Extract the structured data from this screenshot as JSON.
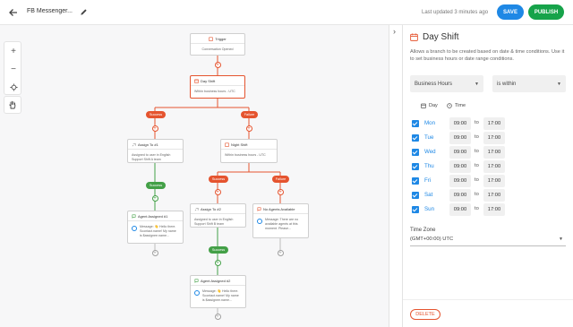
{
  "header": {
    "title": "FB Messenger...",
    "last_updated": "Last updated 3 minutes ago",
    "save_label": "SAVE",
    "publish_label": "PUBLISH"
  },
  "canvas": {
    "zoom_in": "+",
    "zoom_out": "−",
    "nodes": {
      "trigger": {
        "title": "Trigger",
        "body": "Conversation Opened"
      },
      "day_shift": {
        "title": "Day Shift",
        "body": "Within business hours - UTC"
      },
      "assign_1": {
        "title": "Assign To #1",
        "body": "Assigned to user in English Support Shift A team"
      },
      "night_shift": {
        "title": "Night Shift",
        "body": "Within business hours - UTC"
      },
      "agent_assigned_1": {
        "title": "Agent Assigned #1",
        "body": "Message: 👋 Hello there. Scontact.name! My name is $assignee.name..."
      },
      "assign_2": {
        "title": "Assign To #2",
        "body": "Assigned to user in English Support Shift B team"
      },
      "no_agents": {
        "title": "No Agents Available",
        "body": "Message: There are no available agents at this moment. Please..."
      },
      "agent_assigned_2": {
        "title": "Agent Assigned #2",
        "body": "Message: 👋 Hello there. Scontact.name! My name is $assignee.name..."
      }
    },
    "pills": {
      "success": "Success",
      "failure": "Failure"
    }
  },
  "panel": {
    "title": "Day Shift",
    "description": "Allows a branch to be created based on date & time conditions. Use it to set business hours or date range conditions.",
    "condition_field": "Business Hours",
    "condition_operator": "is within",
    "day_header": "Day",
    "time_header": "Time",
    "to_label": "to",
    "days": [
      {
        "name": "Mon",
        "from": "09:00",
        "to": "17:00",
        "checked": true
      },
      {
        "name": "Tue",
        "from": "09:00",
        "to": "17:00",
        "checked": true
      },
      {
        "name": "Wed",
        "from": "09:00",
        "to": "17:00",
        "checked": true
      },
      {
        "name": "Thu",
        "from": "09:00",
        "to": "17:00",
        "checked": true
      },
      {
        "name": "Fri",
        "from": "09:00",
        "to": "17:00",
        "checked": true
      },
      {
        "name": "Sat",
        "from": "09:00",
        "to": "17:00",
        "checked": true
      },
      {
        "name": "Sun",
        "from": "09:00",
        "to": "17:00",
        "checked": true
      }
    ],
    "timezone_label": "Time Zone",
    "timezone_value": "(GMT+00:00) UTC",
    "delete_label": "DELETE"
  },
  "colors": {
    "primary": "#1e88e5",
    "publish": "#16a34a",
    "failure": "#e5542f",
    "success": "#43a047"
  }
}
